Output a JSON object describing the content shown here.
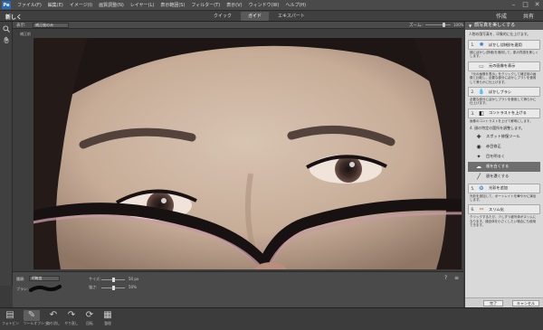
{
  "app": {
    "logo": "Pe"
  },
  "menu": [
    "ファイル(F)",
    "編集(E)",
    "イメージ(I)",
    "画質調整(N)",
    "レイヤー(L)",
    "表示範囲(S)",
    "フィルター(T)",
    "表示(V)",
    "ウィンドウ(W)",
    "ヘルプ(H)"
  ],
  "window_controls": [
    "–",
    "□",
    "✕"
  ],
  "modebar": {
    "left_label": "新しく",
    "tabs": [
      "クイック",
      "ガイド",
      "エキスパート"
    ],
    "active_tab": "ガイド",
    "create": "作成",
    "share": "共有"
  },
  "options": {
    "view_label": "表示:",
    "view_value": "補正後のみ",
    "zoom_label": "ズーム:",
    "zoom_value": "100%"
  },
  "document": {
    "tab_label": "補正前"
  },
  "tool_options": {
    "mode_label": "種類:",
    "mode_value": "明瞭度",
    "brush_label": "ブラシ:",
    "size_label": "サイズ:",
    "size_value": "50 px",
    "strength_label": "強さ:",
    "strength_value": "50%"
  },
  "bottombar": [
    {
      "label": "フォトビン",
      "icon": "photo-bin-icon"
    },
    {
      "label": "ツールオプション",
      "icon": "tool-options-icon"
    },
    {
      "label": "取り消し",
      "icon": "undo-icon"
    },
    {
      "label": "やり直し",
      "icon": "redo-icon"
    },
    {
      "label": "回転",
      "icon": "rotate-icon"
    },
    {
      "label": "整理",
      "icon": "organize-icon"
    }
  ],
  "guide": {
    "title": "顔写真を美しくする",
    "intro": "人物の顔写真を、印象的に仕上げます。",
    "steps": [
      {
        "num": "1.",
        "label": "ぼかし(詳細)を適用",
        "desc": "顔にぼかし(詳細)を適用して、肌の質感を美しくします。"
      },
      {
        "num": "",
        "label": "元の画像を表示",
        "desc": "「元の画像を表示」をクリックして補正前の画像と比較し、必要な部分にぼかしブラシを使用して滑らかに仕上げます。"
      },
      {
        "num": "2.",
        "label": "ぼかしブラシ",
        "desc": "必要な部分にぼかしブラシを使用して滑らかに仕上げます。"
      },
      {
        "num": "3.",
        "label": "コントラストを上げる",
        "desc": "画像のコントラストを上げて鮮明にします。"
      }
    ],
    "step4": "4. 顔の特定の箇所を調整します。",
    "sub_options": [
      "スポット修復ツール",
      "赤目修正",
      "目を明るく",
      "歯を白くする",
      "眉を濃くする"
    ],
    "selected_sub": "歯を白くする",
    "step5": {
      "num": "5.",
      "label": "光彩を追加",
      "desc": "光彩を追加して、ポートレイトを華やかに演出します。"
    },
    "step6": {
      "num": "6.",
      "label": "スリム化",
      "desc": "クリックするたび、少しずつ被写体がスリムになります。顔全体を小さくしたい場合にも使用できます。"
    },
    "done": "完了",
    "cancel": "キャンセル"
  }
}
